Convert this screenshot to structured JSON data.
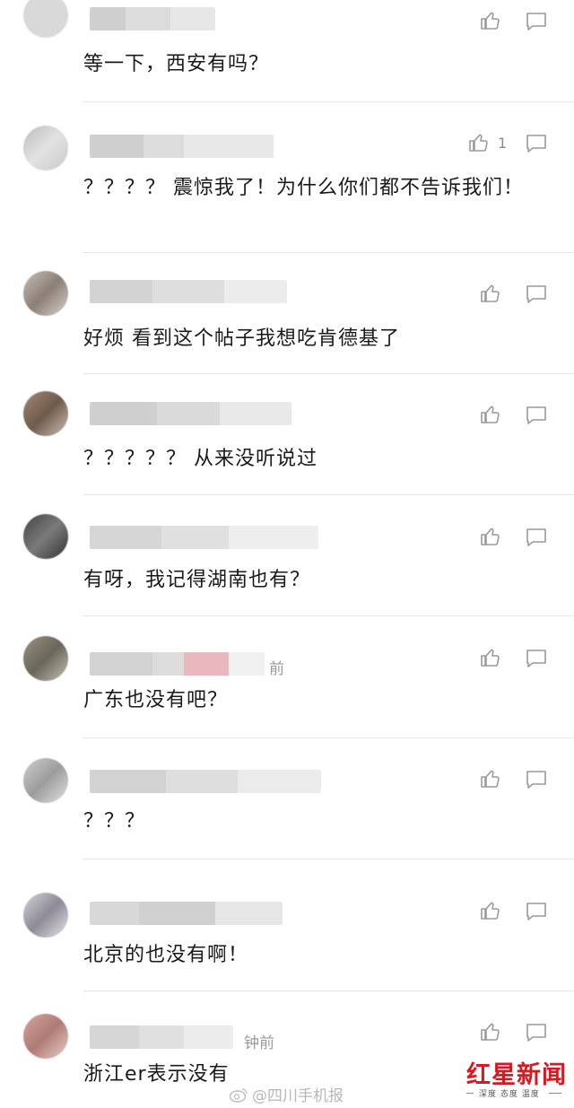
{
  "comments": [
    {
      "text": "等一下，西安有吗？",
      "time": "",
      "likes": ""
    },
    {
      "text": "？？？？ 震惊我了！为什么你们都不告诉我们！",
      "time": "",
      "likes": "1"
    },
    {
      "text": "好烦 看到这个帖子我想吃肯德基了",
      "time": "",
      "likes": ""
    },
    {
      "text": "？？？？？ 从来没听说过",
      "time": "",
      "likes": ""
    },
    {
      "text": "有呀，我记得湖南也有？",
      "time": "",
      "likes": ""
    },
    {
      "text": "广东也没有吧？",
      "time": "前",
      "likes": ""
    },
    {
      "text": "？？？",
      "time": "",
      "likes": ""
    },
    {
      "text": "北京的也没有啊！",
      "time": "",
      "likes": ""
    },
    {
      "text": "浙江er表示没有",
      "time": "钟前",
      "likes": ""
    }
  ],
  "watermark": {
    "text": "@四川手机报",
    "icon": "weibo-icon"
  },
  "brand": {
    "name": "红星新闻",
    "tagline": "深度 态度 温度",
    "color": "#d71920"
  }
}
